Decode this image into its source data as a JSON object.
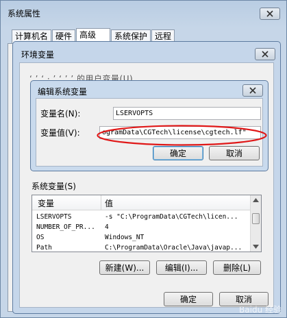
{
  "system_properties": {
    "title": "系统属性",
    "tabs": [
      "计算机名",
      "硬件",
      "高级",
      "系统保护",
      "远程"
    ],
    "active_tab": "高级"
  },
  "env_dialog": {
    "title": "环境变量",
    "user_vars_label_partial": "‘ ’ ‘ · ’ ‘ ’ ’ 的用户变量(U)",
    "system_vars_label": "系统变量(S)",
    "columns": [
      "变量",
      "值"
    ],
    "rows": [
      {
        "name": "LSERVOPTS",
        "value": "-s \"C:\\ProgramData\\CGTech\\licen..."
      },
      {
        "name": "NUMBER_OF_PR...",
        "value": "4"
      },
      {
        "name": "OS",
        "value": "Windows_NT"
      },
      {
        "name": "Path",
        "value": "C:\\ProgramData\\Oracle\\Java\\javap..."
      }
    ],
    "buttons": {
      "new": "新建(W)...",
      "edit": "编辑(I)...",
      "delete": "删除(L)"
    },
    "ok": "确定",
    "cancel": "取消"
  },
  "edit_dialog": {
    "title": "编辑系统变量",
    "name_label": "变量名(N):",
    "value_label": "变量值(V):",
    "name_value": "LSERVOPTS",
    "value_value": "ogramData\\CGTech\\license\\cgtech.lf\"",
    "ok": "确定",
    "cancel": "取消"
  },
  "watermark": "Baidu 经验",
  "colors": {
    "highlight_ellipse": "#e01818",
    "title_bar": "#c5d6ea"
  }
}
